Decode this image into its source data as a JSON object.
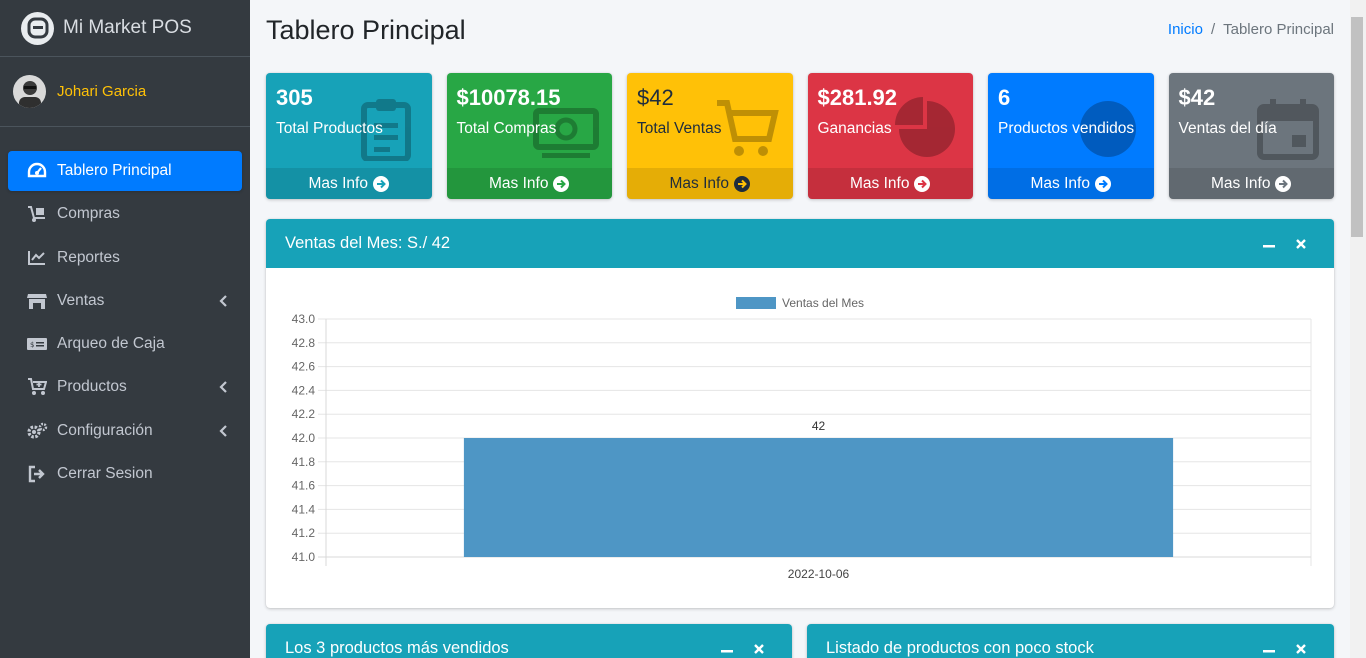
{
  "brand": {
    "title": "Mi Market POS"
  },
  "user": {
    "name": "Johari Garcia"
  },
  "sidebar": {
    "items": [
      {
        "label": "Tablero Principal",
        "icon": "tachometer-icon",
        "active": true,
        "caret": false
      },
      {
        "label": "Compras",
        "icon": "dolly-icon",
        "active": false,
        "caret": false
      },
      {
        "label": "Reportes",
        "icon": "chart-line-icon",
        "active": false,
        "caret": false
      },
      {
        "label": "Ventas",
        "icon": "store-icon",
        "active": false,
        "caret": true
      },
      {
        "label": "Arqueo de Caja",
        "icon": "money-check-icon",
        "active": false,
        "caret": false
      },
      {
        "label": "Productos",
        "icon": "cart-plus-icon",
        "active": false,
        "caret": true
      },
      {
        "label": "Configuración",
        "icon": "cogs-icon",
        "active": false,
        "caret": true
      },
      {
        "label": "Cerrar Sesion",
        "icon": "sign-out-icon",
        "active": false,
        "caret": false
      }
    ]
  },
  "header": {
    "title": "Tablero Principal",
    "breadcrumb": {
      "home": "Inicio",
      "separator": "/",
      "current": "Tablero Principal"
    }
  },
  "boxes": [
    {
      "value": "305",
      "label": "Total Productos",
      "footer": "Mas Info",
      "color": "#17a2b8",
      "icon": "clipboard-icon"
    },
    {
      "value": "$10078.15",
      "label": "Total Compras",
      "footer": "Mas Info",
      "color": "#28a745",
      "icon": "money-bill-icon"
    },
    {
      "value": "$42",
      "label": "Total Ventas",
      "footer": "Mas Info",
      "color": "#ffc107",
      "icon": "shopping-cart-icon"
    },
    {
      "value": "$281.92",
      "label": "Ganancias",
      "footer": "Mas Info",
      "color": "#dc3545",
      "icon": "pie-chart-icon"
    },
    {
      "value": "6",
      "label": "Productos vendidos",
      "footer": "Mas Info",
      "color": "#007bff",
      "icon": "circle-icon"
    },
    {
      "value": "$42",
      "label": "Ventas del día",
      "footer": "Mas Info",
      "color": "#6c757d",
      "icon": "calendar-icon"
    }
  ],
  "sales_card": {
    "title": "Ventas del Mes: S./ 42"
  },
  "bottom_cards": [
    {
      "title": "Los 3 productos más vendidos"
    },
    {
      "title": "Listado de productos con poco stock"
    }
  ],
  "chart_data": {
    "type": "bar",
    "categories": [
      "2022-10-06"
    ],
    "series": [
      {
        "name": "Ventas del Mes",
        "values": [
          42
        ],
        "color": "#4e96c5"
      }
    ],
    "data_labels": [
      "42"
    ],
    "ylim": [
      41.0,
      43.0
    ],
    "yticks": [
      "43.0",
      "42.8",
      "42.6",
      "42.4",
      "42.2",
      "42.0",
      "41.8",
      "41.6",
      "41.4",
      "41.2",
      "41.0"
    ],
    "legend": "top-center",
    "grid": true
  }
}
